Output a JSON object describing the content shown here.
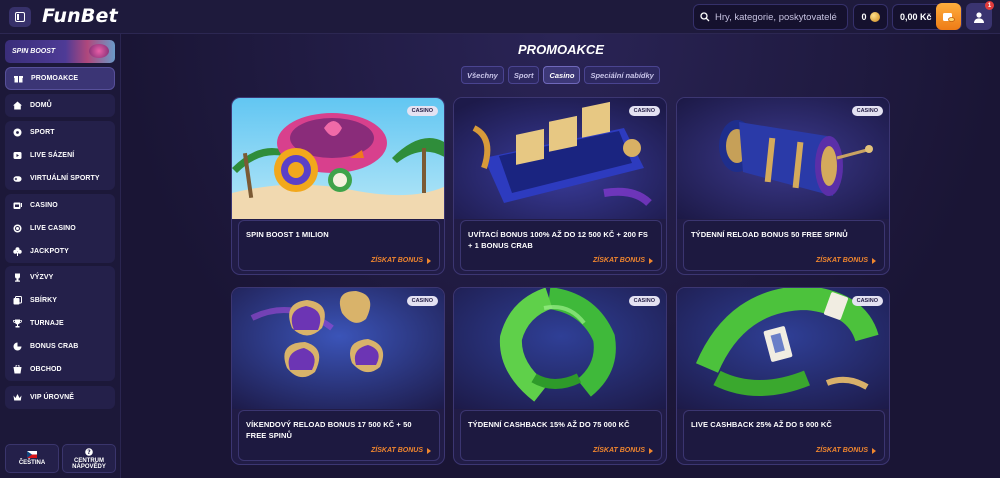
{
  "header": {
    "logo": "FunBet",
    "search_placeholder": "Hry, kategorie, poskytovatelé",
    "coins": "0",
    "balance": "0,00 Kč",
    "notifications": "1"
  },
  "sidebar": {
    "boost_label": "SPIN BOOST",
    "items": [
      {
        "label": "PROMOAKCE",
        "icon": "gift-icon"
      },
      {
        "label": "DOMŮ",
        "icon": "home-icon"
      },
      {
        "label": "SPORT",
        "icon": "ball-icon"
      },
      {
        "label": "LIVE SÁZENÍ",
        "icon": "live-icon"
      },
      {
        "label": "VIRTUÁLNÍ SPORTY",
        "icon": "gamepad-icon"
      },
      {
        "label": "CASINO",
        "icon": "slots-icon"
      },
      {
        "label": "LIVE CASINO",
        "icon": "chip-icon"
      },
      {
        "label": "JACKPOTY",
        "icon": "clover-icon"
      },
      {
        "label": "VÝZVY",
        "icon": "challenge-icon"
      },
      {
        "label": "SBÍRKY",
        "icon": "collection-icon"
      },
      {
        "label": "TURNAJE",
        "icon": "trophy-icon"
      },
      {
        "label": "BONUS CRAB",
        "icon": "crab-icon"
      },
      {
        "label": "OBCHOD",
        "icon": "shop-icon"
      },
      {
        "label": "VIP ÚROVNĚ",
        "icon": "crown-icon"
      }
    ],
    "language": "ČEŠTINA",
    "help_line1": "CENTRUM",
    "help_line2": "NÁPOVĚDY"
  },
  "main": {
    "title": "PROMOAKCE",
    "tabs": [
      "Všechny",
      "Sport",
      "Casino",
      "Speciální nabídky"
    ],
    "active_tab": "Casino",
    "cards": [
      {
        "badge": "CASINO",
        "title": "SPIN BOOST 1 MILION",
        "cta": "ZÍSKAT BONUS"
      },
      {
        "badge": "CASINO",
        "title": "UVÍTACÍ BONUS 100% AŽ DO 12 500 KČ + 200 FS + 1 BONUS CRAB",
        "cta": "ZÍSKAT BONUS"
      },
      {
        "badge": "CASINO",
        "title": "TÝDENNÍ RELOAD BONUS 50 FREE SPINŮ",
        "cta": "ZÍSKAT BONUS"
      },
      {
        "badge": "CASINO",
        "title": "VÍKENDOVÝ RELOAD BONUS 17 500 KČ + 50 FREE SPINŮ",
        "cta": "ZÍSKAT BONUS"
      },
      {
        "badge": "CASINO",
        "title": "TÝDENNÍ CASHBACK 15% AŽ DO 75 000 KČ",
        "cta": "ZÍSKAT BONUS"
      },
      {
        "badge": "CASINO",
        "title": "LIVE CASHBACK 25% AŽ DO 5 000 KČ",
        "cta": "ZÍSKAT BONUS"
      }
    ]
  },
  "colors": {
    "accent": "#f0862e",
    "background": "#1a1535",
    "card": "#211c46"
  }
}
